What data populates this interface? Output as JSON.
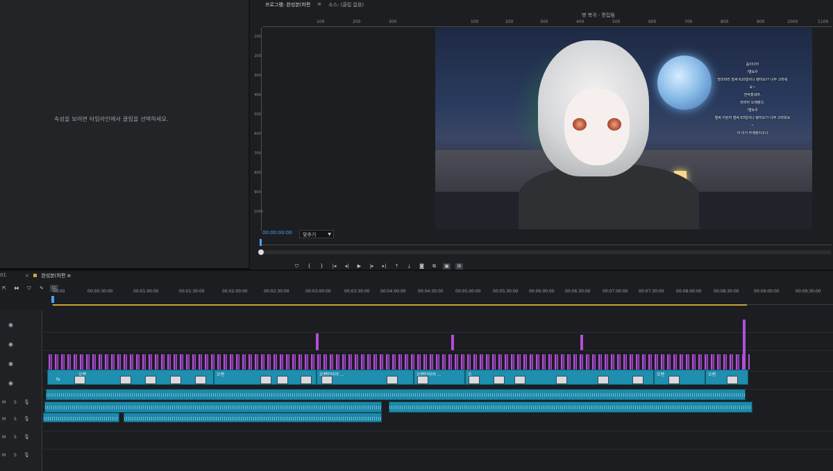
{
  "effect_panel": {
    "hint": "속성을 보려면 타임라인에서 클립을 선택하세요."
  },
  "program": {
    "tabs": [
      "프로그램: 완성본(하편",
      "≡",
      "소스: (클립 없음)"
    ],
    "sequence_title": "병 복귀 - 편집됨",
    "ruler_labels": [
      "100",
      "200",
      "300",
      "100",
      "200",
      "300",
      "400",
      "500",
      "600",
      "700",
      "800",
      "900",
      "1000",
      "1100"
    ],
    "vertical_ruler_labels": [
      "100",
      "200",
      "300",
      "400",
      "500",
      "600",
      "700",
      "800",
      "900",
      "1000"
    ],
    "chat_lines": [
      "춥이다아",
      "!멸토우",
      "땅조바리 벌써 620일이나 됐어요?? 너무 고마워",
      "요~",
      "천작했네여.",
      "와따아 오래됐다.",
      "!멸토우",
      "벌써 이런지 벌써 63일이나 됐어요?? 너무 고마워요",
      "~",
      "아 이거 부계정이구나"
    ],
    "timecode": "00:00:00:00",
    "fit_label": "맞추기"
  },
  "transport": {
    "icons": [
      "marker-icon",
      "in-point-icon",
      "out-point-icon",
      "go-in-icon",
      "step-back-icon",
      "play-icon",
      "step-forward-icon",
      "go-out-icon",
      "lift-icon",
      "extract-icon",
      "export-frame-icon",
      "compare-icon",
      "vr-icon",
      "settings-icon"
    ]
  },
  "timeline": {
    "panel_number": "01",
    "sequence_name": "완성본(하편",
    "menu_glyph": "≡",
    "timecodes": [
      "00:00",
      "00:00:30:00",
      "00:01:00:00",
      "00:01:30:00",
      "00:02:00:00",
      "00:02:30:00",
      "00:03:00:00",
      "00:03:30:00",
      "00:04:00:00",
      "00:04:30:00",
      "00:05:00:00",
      "00:05:30:00",
      "00:06:00:00",
      "00:06:30:00",
      "00:07:00:00",
      "00:07:30:00",
      "00:08:00:00",
      "00:08:30:00",
      "00:09:00:00",
      "00:09:30:00"
    ],
    "cc_label": "CC",
    "track_toggle": "M",
    "track_solo": "S",
    "clip_labels": [
      "오렌",
      "오렌",
      "오렌만이야 ...",
      "오렌만이야 ...",
      "오",
      "오렌",
      "오렌"
    ],
    "fx_label": "fx"
  },
  "colors": {
    "video_clip": "#1e8fae",
    "audio_clip": "#1e88a8",
    "adjustment_clip": "#b04fd9",
    "work_area": "#c9a636",
    "playhead": "#4aa3ff"
  }
}
